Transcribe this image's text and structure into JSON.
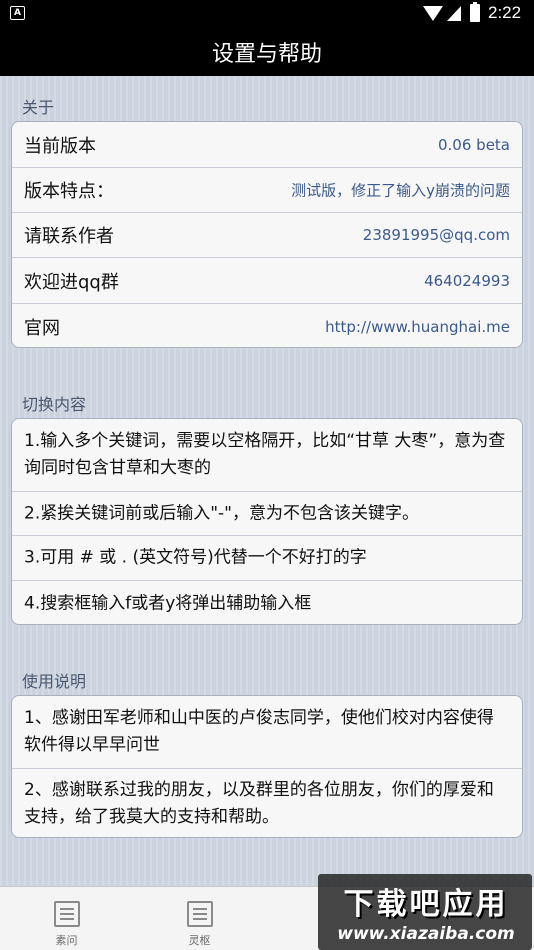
{
  "status_bar": {
    "notification_icon": "A",
    "time": "2:22",
    "icons": [
      "wifi-icon",
      "signal-icon",
      "battery-icon"
    ]
  },
  "title": "设置与帮助",
  "about": {
    "header": "关于",
    "rows": [
      {
        "label": "当前版本",
        "value": "0.06 beta"
      },
      {
        "label": "版本特点：",
        "value": "测试版，修正了输入y崩溃的问题"
      },
      {
        "label": "请联系作者",
        "value": "23891995@qq.com"
      },
      {
        "label": "欢迎进qq群",
        "value": "464024993"
      },
      {
        "label": "官网",
        "value": "http://www.huanghai.me"
      }
    ]
  },
  "switch_content": {
    "header": "切换内容",
    "items": [
      "1.输入多个关键词，需要以空格隔开，比如“甘草  大枣”，意为查询同时包含甘草和大枣的",
      "2.紧挨关键词前或后输入\"-\"，意为不包含该关键字。",
      "3.可用 # 或 . (英文符号)代替一个不好打的字",
      "4.搜索框输入f或者y将弹出辅助输入框"
    ]
  },
  "usage": {
    "header": "使用说明",
    "items": [
      "1、感谢田军老师和山中医的卢俊志同学，使他们校对内容使得软件得以早早问世",
      "2、感谢联系过我的朋友，以及群里的各位朋友，你们的厚爱和支持，给了我莫大的支持和帮助。"
    ]
  },
  "tab_bar": {
    "tabs": [
      {
        "label": "素问",
        "icon": "list-icon"
      },
      {
        "label": "灵枢",
        "icon": "list-icon"
      }
    ]
  },
  "watermark": {
    "logo_text": "下载吧应用",
    "url": "www.xiazaiba.com"
  },
  "colors": {
    "accent_text": "#3b5a8c",
    "title_bar": "#000000",
    "background": "#ccd3de"
  }
}
